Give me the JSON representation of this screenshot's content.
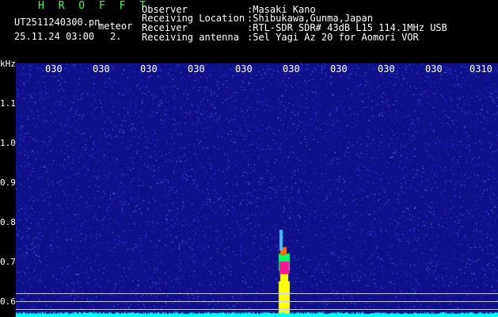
{
  "header": {
    "program": "H R O F F T",
    "filename": "UT2511240300.pn",
    "mode": "meteor",
    "date_time": "25.11.24 03:00",
    "index": "2.",
    "fields": [
      {
        "label": "Observer",
        "value": ":Masaki Kano"
      },
      {
        "label": "Receiving Location",
        "value": ":Shibukawa,Gunma,Japan"
      },
      {
        "label": "Receiver",
        "value": ":RTL-SDR SDR# 43dB L15 114.1MHz USB"
      },
      {
        "label": "Receiving antenna",
        "value": ":5el Yagi Az 20 for Aomori VOR"
      }
    ]
  },
  "axis": {
    "y_unit": "kHz",
    "y_ticks": [
      "1.1",
      "1.0",
      "0.9",
      "0.8",
      "0.7",
      "0.6"
    ],
    "x_ticks": [
      "030",
      "030",
      "030",
      "030",
      "030",
      "030",
      "030",
      "030",
      "030",
      "0310"
    ]
  },
  "colors": {
    "background": "#10108a",
    "spike_top": "#ff1493",
    "spike_body": "#ffff00",
    "floor": "#00ffff"
  }
}
